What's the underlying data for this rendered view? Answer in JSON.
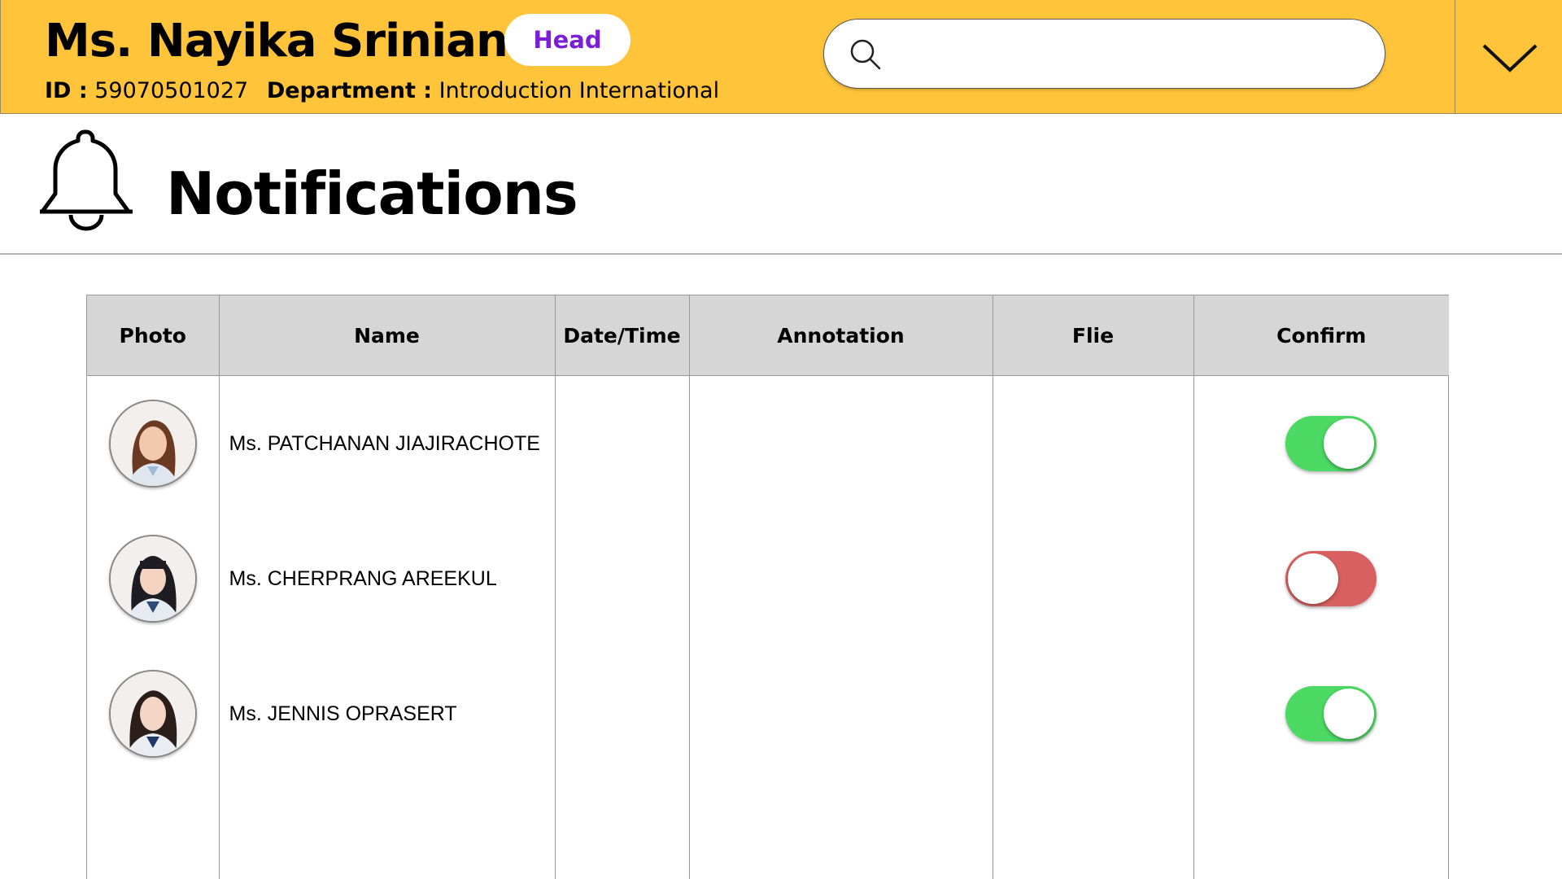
{
  "header": {
    "user_name": "Ms. Nayika Srinian",
    "role_badge": "Head",
    "id_label": "ID :",
    "id_value": "59070501027",
    "department_label": "Department :",
    "department_value": "Introduction International",
    "search": {
      "value": "",
      "placeholder": ""
    },
    "background_color": "#FFC43A"
  },
  "page": {
    "title": "Notifications",
    "icon": "bell-icon"
  },
  "table": {
    "columns": [
      "Photo",
      "Name",
      "Date/Time",
      "Annotation",
      "Flie",
      "Confirm"
    ],
    "rows": [
      {
        "name": "Ms. PATCHANAN JIAJIRACHOTE",
        "date_time": "",
        "annotation": "",
        "file": "",
        "confirmed": true
      },
      {
        "name": "Ms. CHERPRANG AREEKUL",
        "date_time": "",
        "annotation": "",
        "file": "",
        "confirmed": false
      },
      {
        "name": "Ms. JENNIS OPRASERT",
        "date_time": "",
        "annotation": "",
        "file": "",
        "confirmed": true
      }
    ]
  },
  "colors": {
    "toggle_on": "#4CD964",
    "toggle_off": "#D96060",
    "badge_text": "#7A1FD6"
  }
}
